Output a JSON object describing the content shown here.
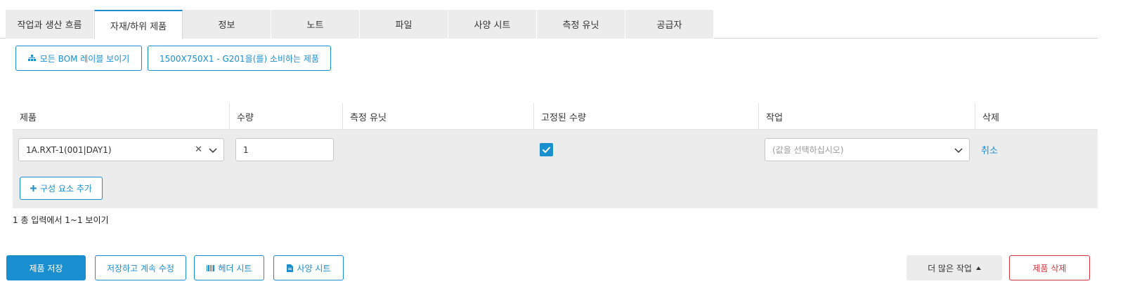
{
  "tabs": [
    {
      "label": "작업과 생산 흐름"
    },
    {
      "label": "자재/하위 제품"
    },
    {
      "label": "정보"
    },
    {
      "label": "노트"
    },
    {
      "label": "파일"
    },
    {
      "label": "사양 시트"
    },
    {
      "label": "측정 유닛"
    },
    {
      "label": "공급자"
    }
  ],
  "active_tab_index": 1,
  "toolbar": {
    "show_bom_label": "모든 BOM 레이블 보이기",
    "consuming_label": "1500X750X1 - G201을(를) 소비하는 제품"
  },
  "table": {
    "headers": {
      "product": "제품",
      "quantity": "수량",
      "unit": "측정 유닛",
      "fixed_qty": "고정된 수량",
      "operation": "작업",
      "delete": "삭제"
    },
    "rows": [
      {
        "product": "1A.RXT-1(001|DAY1)",
        "quantity": "1",
        "unit": "",
        "fixed_qty": true,
        "operation_placeholder": "(값을 선택하십시오)",
        "delete_label": "취소"
      }
    ],
    "add_component_label": "구성 요소 추가"
  },
  "pagination": {
    "summary": "1 총 입력에서 1~1 보이기"
  },
  "footer": {
    "save_label": "제품 저장",
    "save_continue_label": "저장하고 계속 수정",
    "header_sheet_label": "헤더 시트",
    "spec_sheet_label": "사양 시트",
    "more_actions_label": "더 많은 작업",
    "delete_label": "제품 삭제"
  },
  "colors": {
    "accent": "#1a8fd0",
    "danger": "#d0343a",
    "row_bg": "#ececec"
  }
}
